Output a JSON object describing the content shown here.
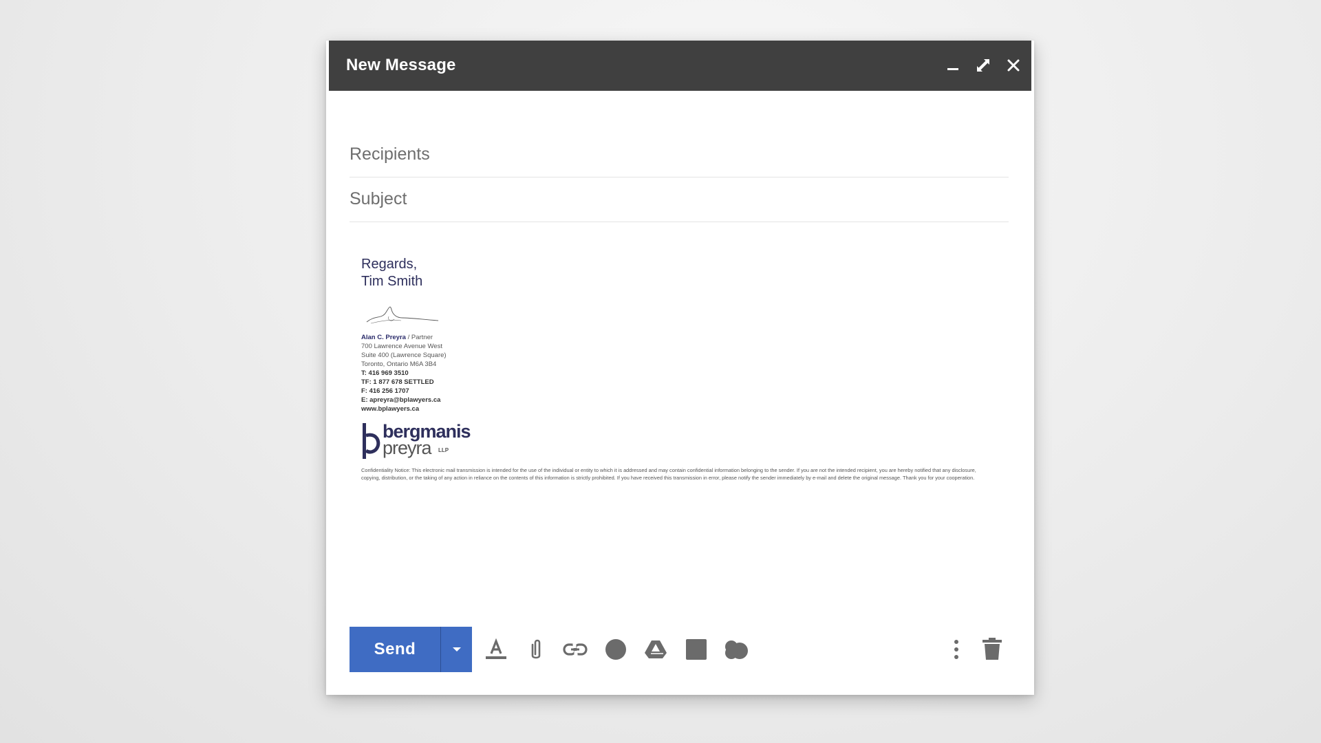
{
  "window": {
    "title": "New Message",
    "controls": [
      "minimize-icon",
      "expand-icon",
      "close-icon"
    ]
  },
  "fields": {
    "recipients_placeholder": "Recipients",
    "subject_placeholder": "Subject"
  },
  "signature": {
    "closing": "Regards,",
    "sender": "Tim Smith",
    "name": "Alan C. Preyra",
    "role": " / Partner",
    "address1": "700 Lawrence Avenue West",
    "address2": "Suite 400 (Lawrence Square)",
    "address3": "Toronto, Ontario  M6A 3B4",
    "phone": "T:   416 969 3510",
    "tollfree": "TF: 1 877 678 SETTLED",
    "fax": "F:   416 256 1707",
    "email": "E:   apreyra@bplawyers.ca",
    "website": "www.bplawyers.ca",
    "logo_line1": "bergmanis",
    "logo_line2": "preyra",
    "logo_suffix": "LLP",
    "notice": "Confidentiality Notice: This electronic mail transmission is intended for the use of the individual or entity to which it is addressed and may contain confidential information belonging to the sender. If you are not the intended recipient, you are hereby notified that any disclosure, copying, distribution, or the taking of any action in reliance on the contents of this information is strictly prohibited. If you have received this transmission in error, please notify the sender immediately by e-mail and delete the original message. Thank you for your cooperation."
  },
  "toolbar": {
    "send_label": "Send",
    "icons": [
      "send-options-icon",
      "text-format-icon",
      "attach-icon",
      "link-icon",
      "emoji-icon",
      "drive-icon",
      "photo-icon",
      "confidential-icon",
      "more-options-icon",
      "trash-icon"
    ]
  },
  "colors": {
    "titlebar": "#404040",
    "send_button": "#3f6cc3",
    "icon_gray": "#6b6b6b",
    "signature_navy": "#2e2f5c"
  }
}
